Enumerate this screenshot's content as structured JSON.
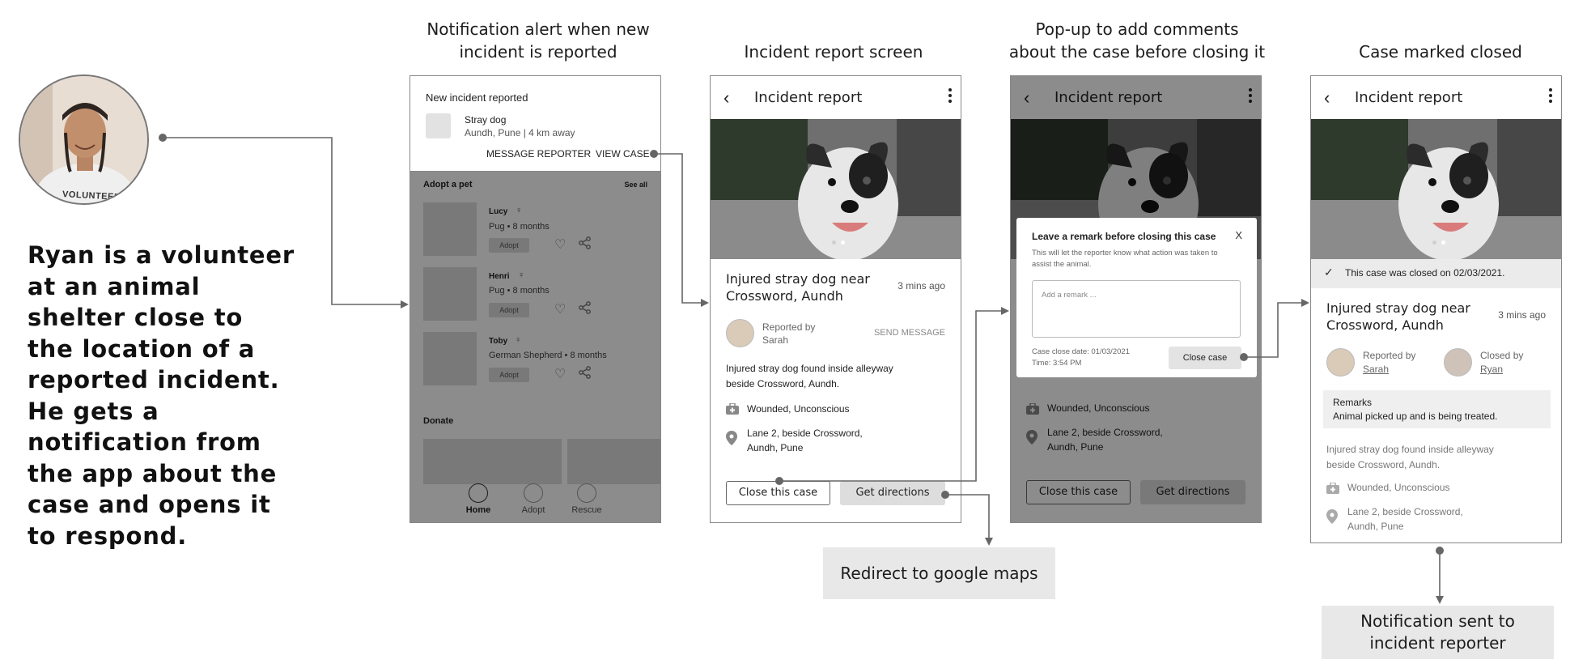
{
  "persona": {
    "story": "Ryan is a volunteer at an animal shelter close to the location of a reported incident. He gets a notification from the app about the case and opens it to respond.",
    "shirt_text": "VOLUNTEER"
  },
  "captions": {
    "notification": [
      "Notification alert when new",
      "incident is reported"
    ],
    "incident": "Incident report screen",
    "popup": [
      "Pop-up to add comments",
      "about the case before closing it"
    ],
    "closed": "Case marked closed"
  },
  "notification_screen": {
    "card_title": "New incident reported",
    "item_title": "Stray dog",
    "item_sub": "Aundh, Pune | 4 km away",
    "message_reporter": "MESSAGE REPORTER",
    "view_case": "VIEW CASE",
    "adopt_heading": "Adopt a pet",
    "see_all": "See all",
    "pets": [
      {
        "name": "Lucy",
        "detail": "Pug • 8 months",
        "adopt": "Adopt"
      },
      {
        "name": "Henri",
        "detail": "Pug • 8 months",
        "adopt": "Adopt"
      },
      {
        "name": "Toby",
        "detail": "German Shepherd • 8 months",
        "adopt": "Adopt"
      }
    ],
    "donate_heading": "Donate",
    "nav": [
      "Home",
      "Adopt",
      "Rescue"
    ]
  },
  "incident_screen": {
    "title": "Incident report",
    "case_title": "Injured stray dog near Crossword, Aundh",
    "time": "3 mins ago",
    "reported_by_label": "Reported by",
    "reporter": "Sarah",
    "send_message": "SEND MESSAGE",
    "description": "Injured stray dog found inside alleyway beside Crossword, Aundh.",
    "condition": "Wounded, Unconscious",
    "address": "Lane 2, beside Crossword, Aundh, Pune",
    "close_button": "Close this case",
    "directions_button": "Get directions"
  },
  "popup_screen": {
    "title": "Incident report",
    "modal_title": "Leave a remark before closing this case",
    "modal_close": "X",
    "modal_sub": "This will let the reporter know what action was taken to assist the animal.",
    "placeholder": "Add a remark ...",
    "close_date": "Case close date: 01/03/2021",
    "close_time": "Time: 3:54 PM",
    "close_case_button": "Close case",
    "condition": "Wounded, Unconscious",
    "address": "Lane 2, beside Crossword, Aundh, Pune",
    "close_button": "Close this case",
    "directions_button": "Get directions"
  },
  "closed_screen": {
    "title": "Incident report",
    "banner": "This case was closed on 02/03/2021.",
    "case_title": "Injured stray dog near Crossword, Aundh",
    "time": "3 mins ago",
    "reported_by_label": "Reported by",
    "reporter": "Sarah",
    "closed_by_label": "Closed by",
    "closer": "Ryan",
    "remarks_label": "Remarks",
    "remarks_text": "Animal picked up and is being treated.",
    "description": "Injured stray dog found inside alleyway beside Crossword, Aundh.",
    "condition": "Wounded, Unconscious",
    "address": "Lane 2, beside Crossword, Aundh, Pune"
  },
  "callouts": {
    "maps": "Redirect to google maps",
    "notify": [
      "Notification sent to",
      "incident reporter"
    ]
  },
  "colors": {
    "connector": "#666666",
    "shade": "#000000",
    "callout_bg": "#e8e8e8"
  }
}
